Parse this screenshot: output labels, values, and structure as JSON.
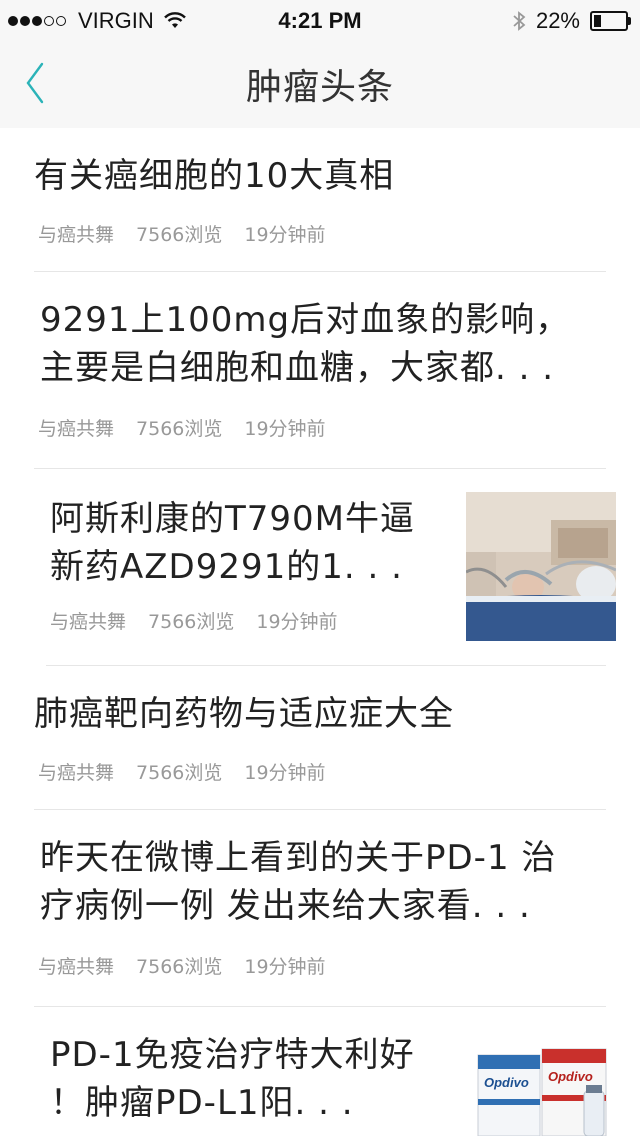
{
  "status_bar": {
    "carrier": "VIRGIN",
    "time": "4:21 PM",
    "battery_percent": "22%",
    "battery_level": 0.22
  },
  "nav": {
    "title": "肿瘤头条"
  },
  "articles": [
    {
      "title": "有关癌细胞的10大真相",
      "source": "与癌共舞",
      "views": "7566浏览",
      "time": "19分钟前"
    },
    {
      "title": "9291上100mg后对血象的影响，\n主要是白细胞和血糖，大家都. . .",
      "source": "与癌共舞",
      "views": "7566浏览",
      "time": "19分钟前"
    },
    {
      "title": "阿斯利康的T790M牛逼\n新药AZD9291的1. . .",
      "source": "与癌共舞",
      "views": "7566浏览",
      "time": "19分钟前"
    },
    {
      "title": "肺癌靶向药物与适应症大全",
      "source": "与癌共舞",
      "views": "7566浏览",
      "time": "19分钟前"
    },
    {
      "title": "昨天在微博上看到的关于PD-1 治\n疗病例一例 发出来给大家看. . .",
      "source": "与癌共舞",
      "views": "7566浏览",
      "time": "19分钟前"
    },
    {
      "title": "PD-1免疫治疗特大利好\n！肿瘤PD-L1阳. . .",
      "thumb_brand": "Opdivo"
    }
  ]
}
